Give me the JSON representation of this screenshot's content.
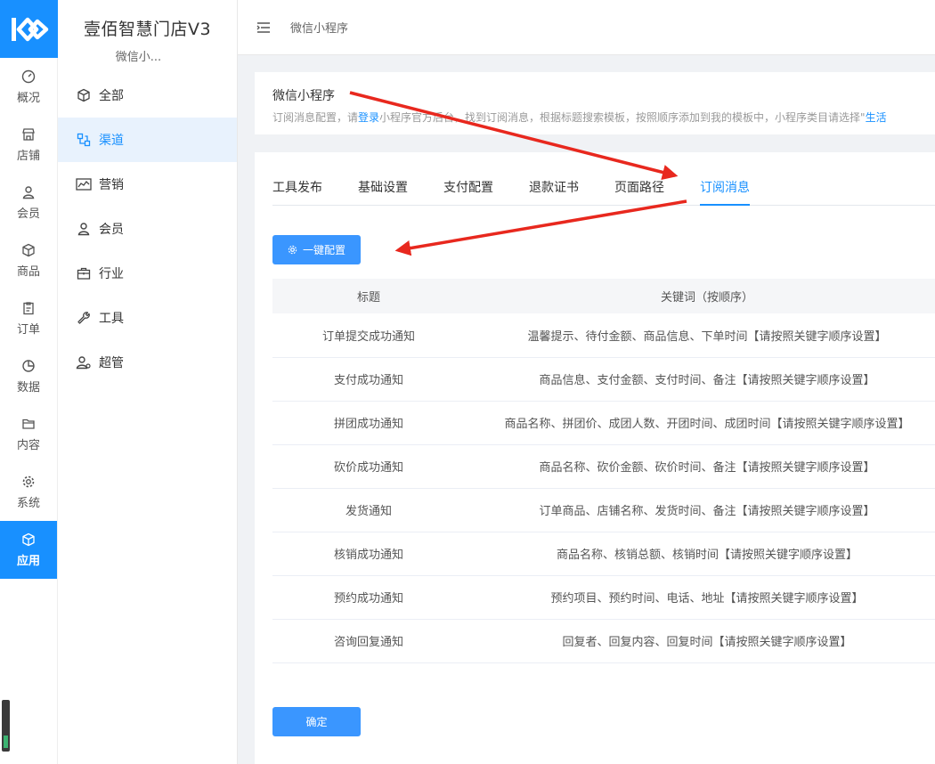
{
  "rail": {
    "items": [
      {
        "label": "概况",
        "icon": "dashboard-icon"
      },
      {
        "label": "店铺",
        "icon": "store-icon"
      },
      {
        "label": "会员",
        "icon": "user-icon"
      },
      {
        "label": "商品",
        "icon": "cube-icon"
      },
      {
        "label": "订单",
        "icon": "clipboard-icon"
      },
      {
        "label": "数据",
        "icon": "pie-chart-icon"
      },
      {
        "label": "内容",
        "icon": "folder-icon"
      },
      {
        "label": "系统",
        "icon": "gear-icon"
      },
      {
        "label": "应用",
        "icon": "cube-icon",
        "active": true
      }
    ],
    "accent": "#1890ff"
  },
  "sidebar": {
    "store_name": "壹佰智慧门店V3",
    "store_sub": "微信小...",
    "items": [
      {
        "label": "全部",
        "icon": "cube-icon"
      },
      {
        "label": "渠道",
        "icon": "channel-icon",
        "active": true
      },
      {
        "label": "营销",
        "icon": "trend-chart-icon"
      },
      {
        "label": "会员",
        "icon": "user-icon"
      },
      {
        "label": "行业",
        "icon": "briefcase-icon"
      },
      {
        "label": "工具",
        "icon": "wrench-icon"
      },
      {
        "label": "超管",
        "icon": "admin-user-icon"
      }
    ]
  },
  "topbar": {
    "breadcrumb": "微信小程序"
  },
  "info": {
    "title": "微信小程序",
    "desc_prefix": "订阅消息配置，请",
    "desc_link1": "登录",
    "desc_mid": "小程序官方后台，找到订阅消息，根据标题搜索模板，按照顺序添加到我的模板中，小程序类目请选择\"",
    "desc_link2": "生活"
  },
  "tabs": [
    {
      "label": "工具发布"
    },
    {
      "label": "基础设置"
    },
    {
      "label": "支付配置"
    },
    {
      "label": "退款证书"
    },
    {
      "label": "页面路径"
    },
    {
      "label": "订阅消息",
      "active": true
    }
  ],
  "buttons": {
    "auto_config": "一键配置",
    "confirm": "确定"
  },
  "table": {
    "headers": [
      "标题",
      "关键词（按顺序）"
    ],
    "rows": [
      [
        "订单提交成功通知",
        "温馨提示、待付金额、商品信息、下单时间【请按照关键字顺序设置】"
      ],
      [
        "支付成功通知",
        "商品信息、支付金额、支付时间、备注【请按照关键字顺序设置】"
      ],
      [
        "拼团成功通知",
        "商品名称、拼团价、成团人数、开团时间、成团时间【请按照关键字顺序设置】"
      ],
      [
        "砍价成功通知",
        "商品名称、砍价金额、砍价时间、备注【请按照关键字顺序设置】"
      ],
      [
        "发货通知",
        "订单商品、店铺名称、发货时间、备注【请按照关键字顺序设置】"
      ],
      [
        "核销成功通知",
        "商品名称、核销总额、核销时间【请按照关键字顺序设置】"
      ],
      [
        "预约成功通知",
        "预约项目、预约时间、电话、地址【请按照关键字顺序设置】"
      ],
      [
        "咨询回复通知",
        "回复者、回复内容、回复时间【请按照关键字顺序设置】"
      ]
    ]
  },
  "annotation_color": "#e8281e"
}
